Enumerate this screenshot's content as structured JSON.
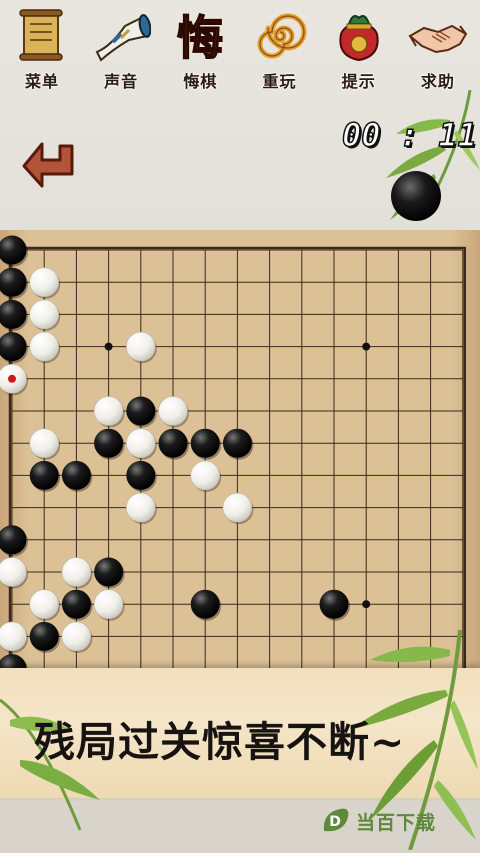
{
  "toolbar": {
    "items": [
      {
        "label": "菜单",
        "icon": "scroll-menu-icon"
      },
      {
        "label": "声音",
        "icon": "horn-sound-icon"
      },
      {
        "label": "悔棋",
        "icon": "regret-character-icon"
      },
      {
        "label": "重玩",
        "icon": "spiral-replay-icon"
      },
      {
        "label": "提示",
        "icon": "lucky-bag-hint-icon"
      },
      {
        "label": "求助",
        "icon": "handshake-help-icon"
      }
    ]
  },
  "timer": {
    "text": "00 : 11"
  },
  "back_button": {
    "icon": "back-arrow-icon"
  },
  "turn_indicator": {
    "stone": "black"
  },
  "board": {
    "size": 15,
    "star_points": [
      [
        3,
        3
      ],
      [
        3,
        11
      ],
      [
        11,
        3
      ],
      [
        11,
        11
      ]
    ],
    "black_stones": [
      [
        0,
        0
      ],
      [
        0,
        1
      ],
      [
        0,
        2
      ],
      [
        0,
        3
      ],
      [
        4,
        5
      ],
      [
        3,
        6
      ],
      [
        5,
        6
      ],
      [
        6,
        6
      ],
      [
        7,
        6
      ],
      [
        1,
        7
      ],
      [
        2,
        7
      ],
      [
        4,
        7
      ],
      [
        0,
        9
      ],
      [
        3,
        10
      ],
      [
        2,
        11
      ],
      [
        6,
        11
      ],
      [
        10,
        11
      ],
      [
        1,
        12
      ],
      [
        0,
        13
      ]
    ],
    "white_stones": [
      [
        1,
        1
      ],
      [
        1,
        2
      ],
      [
        1,
        3
      ],
      [
        4,
        3
      ],
      [
        3,
        5
      ],
      [
        5,
        5
      ],
      [
        4,
        6
      ],
      [
        1,
        6
      ],
      [
        6,
        7
      ],
      [
        4,
        8
      ],
      [
        7,
        8
      ],
      [
        0,
        10
      ],
      [
        2,
        10
      ],
      [
        1,
        11
      ],
      [
        3,
        11
      ],
      [
        0,
        12
      ],
      [
        2,
        12
      ]
    ],
    "last_move": [
      0,
      4
    ],
    "last_move_marker_color": "#d01818"
  },
  "banner": {
    "slogan": "残局过关惊喜不断~"
  },
  "watermark": {
    "text": "当百下载",
    "icon": "leaf-logo-icon"
  },
  "colors": {
    "board": "#ddc196",
    "grid": "#3a2a1a",
    "banner": "#f4e3c4"
  }
}
